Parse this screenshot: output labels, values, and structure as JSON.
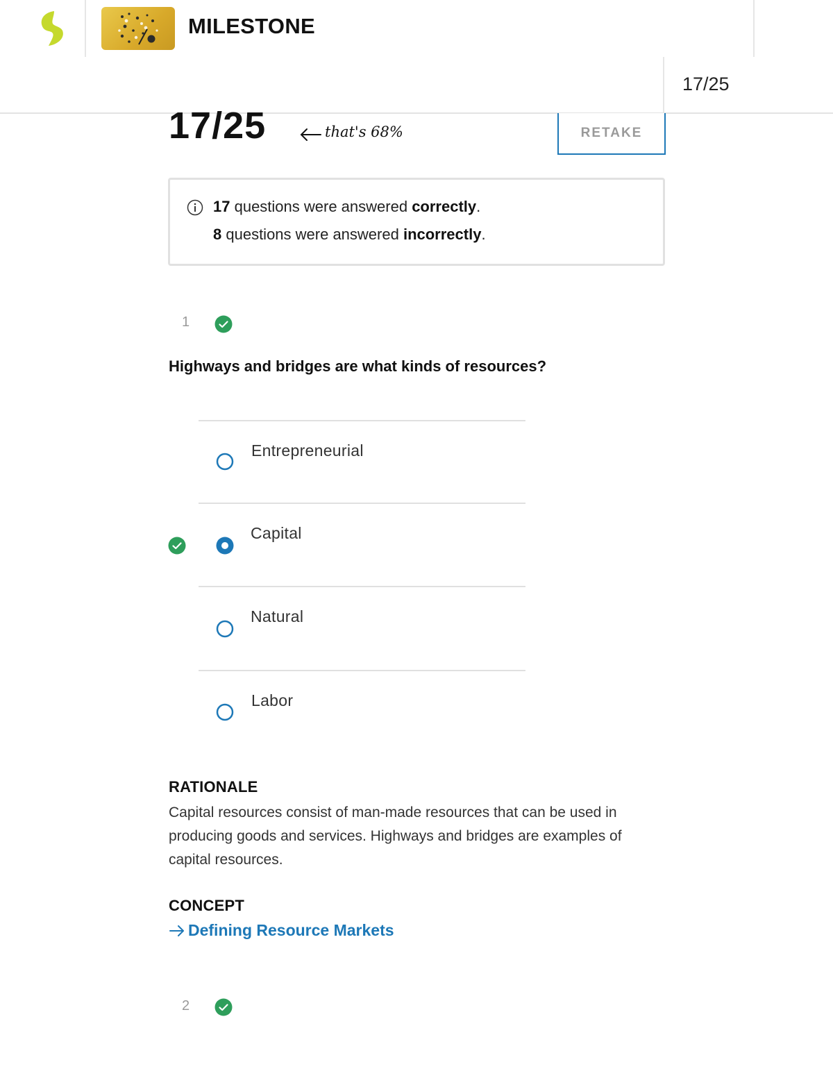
{
  "header": {
    "title": "MILESTONE",
    "progress": "17/25",
    "brand_color": "#c5d92d",
    "logo_icon": "sophia-logo-icon",
    "thumbnail_icon": "milestone-thumbnail-image"
  },
  "score": {
    "value": "17/25",
    "note": "that's 68%",
    "retake_label": "RETAKE"
  },
  "summary": {
    "correct_count": "17",
    "correct_text": " questions were answered ",
    "correct_word": "correctly",
    "incorrect_count": "8",
    "incorrect_text": " questions were answered ",
    "incorrect_word": "incorrectly",
    "period": "."
  },
  "questions": [
    {
      "number": "1",
      "status": "correct",
      "text": "Highways and bridges are what kinds of resources?",
      "options": [
        {
          "label": "Entrepreneurial",
          "selected": false,
          "correct": false
        },
        {
          "label": "Capital",
          "selected": true,
          "correct": true
        },
        {
          "label": "Natural",
          "selected": false,
          "correct": false
        },
        {
          "label": "Labor",
          "selected": false,
          "correct": false
        }
      ],
      "rationale_heading": "RATIONALE",
      "rationale": "Capital resources consist of man-made resources that can be used in producing goods and services. Highways and bridges are examples of capital resources.",
      "concept_heading": "CONCEPT",
      "concept_link": "Defining Resource Markets"
    },
    {
      "number": "2",
      "status": "correct"
    }
  ],
  "colors": {
    "accent_blue": "#1d78b7",
    "correct_green": "#2e9e5b",
    "muted_gray": "#9a9a9a"
  }
}
